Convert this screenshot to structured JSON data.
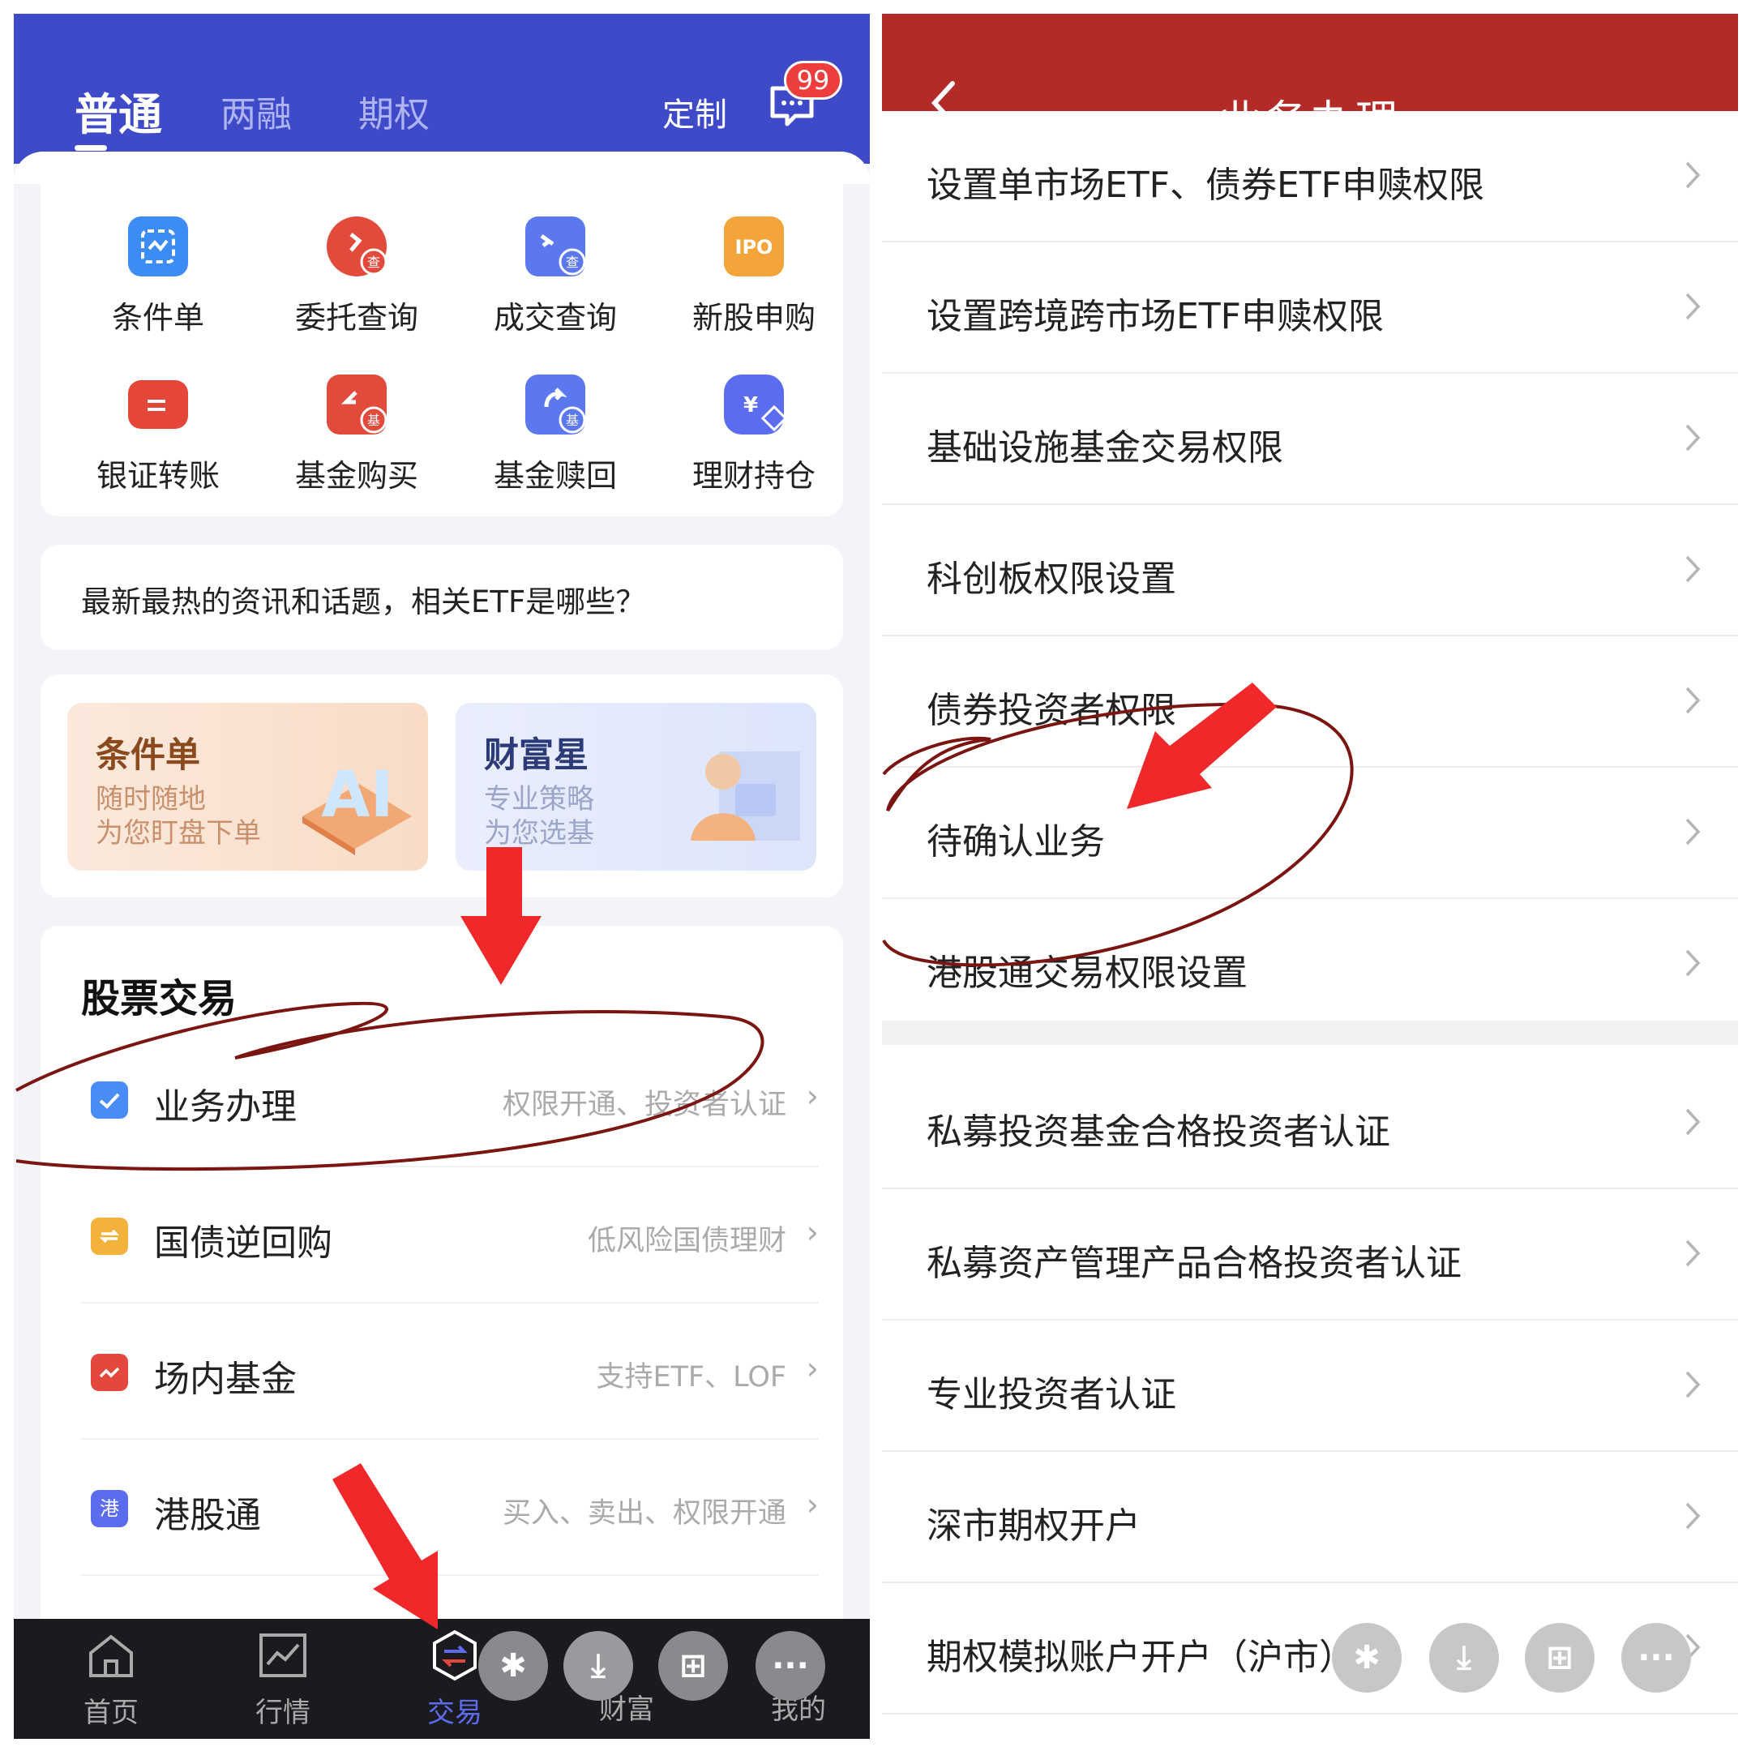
{
  "left": {
    "tabs": [
      "普通",
      "两融",
      "期权"
    ],
    "customize_label": "定制",
    "message_badge": "99",
    "quick_actions": [
      {
        "label": "条件单",
        "icon": "condition-order-icon",
        "color": "#3d8cf5"
      },
      {
        "label": "委托查询",
        "icon": "order-query-icon",
        "color": "#e24a3b"
      },
      {
        "label": "成交查询",
        "icon": "trade-query-icon",
        "color": "#5b78ee"
      },
      {
        "label": "新股申购",
        "icon": "ipo-icon",
        "color": "#f3a43a"
      },
      {
        "label": "银证转账",
        "icon": "bank-transfer-icon",
        "color": "#e4463a"
      },
      {
        "label": "基金购买",
        "icon": "fund-buy-icon",
        "color": "#e24a3b"
      },
      {
        "label": "基金赎回",
        "icon": "fund-redeem-icon",
        "color": "#5b78ee"
      },
      {
        "label": "理财持仓",
        "icon": "wealth-holding-icon",
        "color": "#5b6cee"
      }
    ],
    "news": "最新最热的资讯和话题，相关ETF是哪些？",
    "promos": [
      {
        "title": "条件单",
        "line1": "随时随地",
        "line2": "为您盯盘下单",
        "badge": "AI"
      },
      {
        "title": "财富星",
        "line1": "专业策略",
        "line2": "为您选基"
      }
    ],
    "section_title": "股票交易",
    "stock_rows": [
      {
        "name": "业务办理",
        "desc": "权限开通、投资者认证",
        "icon": "business-check-icon",
        "color": "#4a8cf5"
      },
      {
        "name": "国债逆回购",
        "desc": "低风险国债理财",
        "icon": "repo-icon",
        "color": "#f3b23a"
      },
      {
        "name": "场内基金",
        "desc": "支持ETF、LOF",
        "icon": "exchange-fund-icon",
        "color": "#e2483d"
      },
      {
        "name": "港股通",
        "desc": "买入、卖出、权限开通",
        "icon": "hk-connect-icon",
        "color": "#5b6cee",
        "glyph": "港"
      }
    ],
    "nav": [
      "首页",
      "行情",
      "交易",
      "财富",
      "我的"
    ],
    "chevron": "›"
  },
  "right": {
    "title": "业务办理",
    "rows_group1": [
      "设置单市场ETF、债券ETF申赎权限",
      "设置跨境跨市场ETF申赎权限",
      "基础设施基金交易权限",
      "科创板权限设置",
      "债券投资者权限",
      "待确认业务",
      "港股通交易权限设置"
    ],
    "rows_group2": [
      "私募投资基金合格投资者认证",
      "私募资产管理产品合格投资者认证",
      "专业投资者认证",
      "深市期权开户",
      "期权模拟账户开户（沪市）"
    ]
  },
  "colors": {
    "left_header": "#3f4ac8",
    "right_header": "#b42a27",
    "annotation_arrow": "#f0282a",
    "annotation_circle": "#7a1512"
  }
}
